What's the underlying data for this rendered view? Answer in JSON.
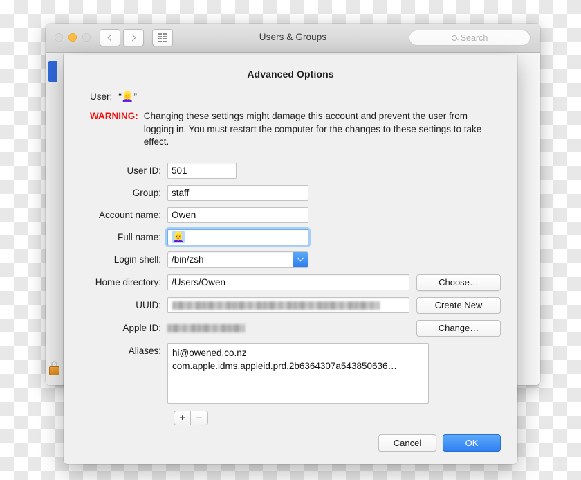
{
  "window": {
    "title": "Users & Groups",
    "traffic_lights": [
      "close-button",
      "minimize-button",
      "zoom-button"
    ],
    "nav": {
      "back": "back-button",
      "forward": "forward-button",
      "show_all": "show-all-button"
    },
    "search": {
      "placeholder": "Search",
      "value": ""
    }
  },
  "sheet": {
    "title": "Advanced Options",
    "user_label": "User:",
    "user_value": "“👱‍♀️”",
    "warning_label": "WARNING:",
    "warning_text": "Changing these settings might damage this account and prevent the user from logging in. You must restart the computer for the changes to these settings to take effect.",
    "fields": {
      "user_id": {
        "label": "User ID:",
        "value": "501"
      },
      "group": {
        "label": "Group:",
        "value": "staff"
      },
      "account_name": {
        "label": "Account name:",
        "value": "Owen"
      },
      "full_name": {
        "label": "Full name:",
        "value": "👱‍♀️",
        "focused": true
      },
      "login_shell": {
        "label": "Login shell:",
        "value": "/bin/zsh"
      },
      "home_directory": {
        "label": "Home directory:",
        "value": "/Users/Owen"
      },
      "uuid": {
        "label": "UUID:",
        "value": "",
        "redacted": true
      },
      "apple_id": {
        "label": "Apple ID:",
        "value": "",
        "redacted": true
      },
      "aliases": {
        "label": "Aliases:"
      }
    },
    "aliases_list": [
      "hi@owened.co.nz",
      "com.apple.idms.appleid.prd.2b6364307a543850636…"
    ],
    "side_buttons": {
      "choose": "Choose…",
      "create_new": "Create New",
      "change": "Change…"
    },
    "list_controls": {
      "add": "+",
      "remove": "−"
    },
    "footer": {
      "cancel": "Cancel",
      "ok": "OK"
    }
  },
  "colors": {
    "warning": "#f20d0d",
    "accent": "#2f80f2",
    "focus_ring": "#6aaef4",
    "sidebar_selection": "#2f69d8"
  }
}
